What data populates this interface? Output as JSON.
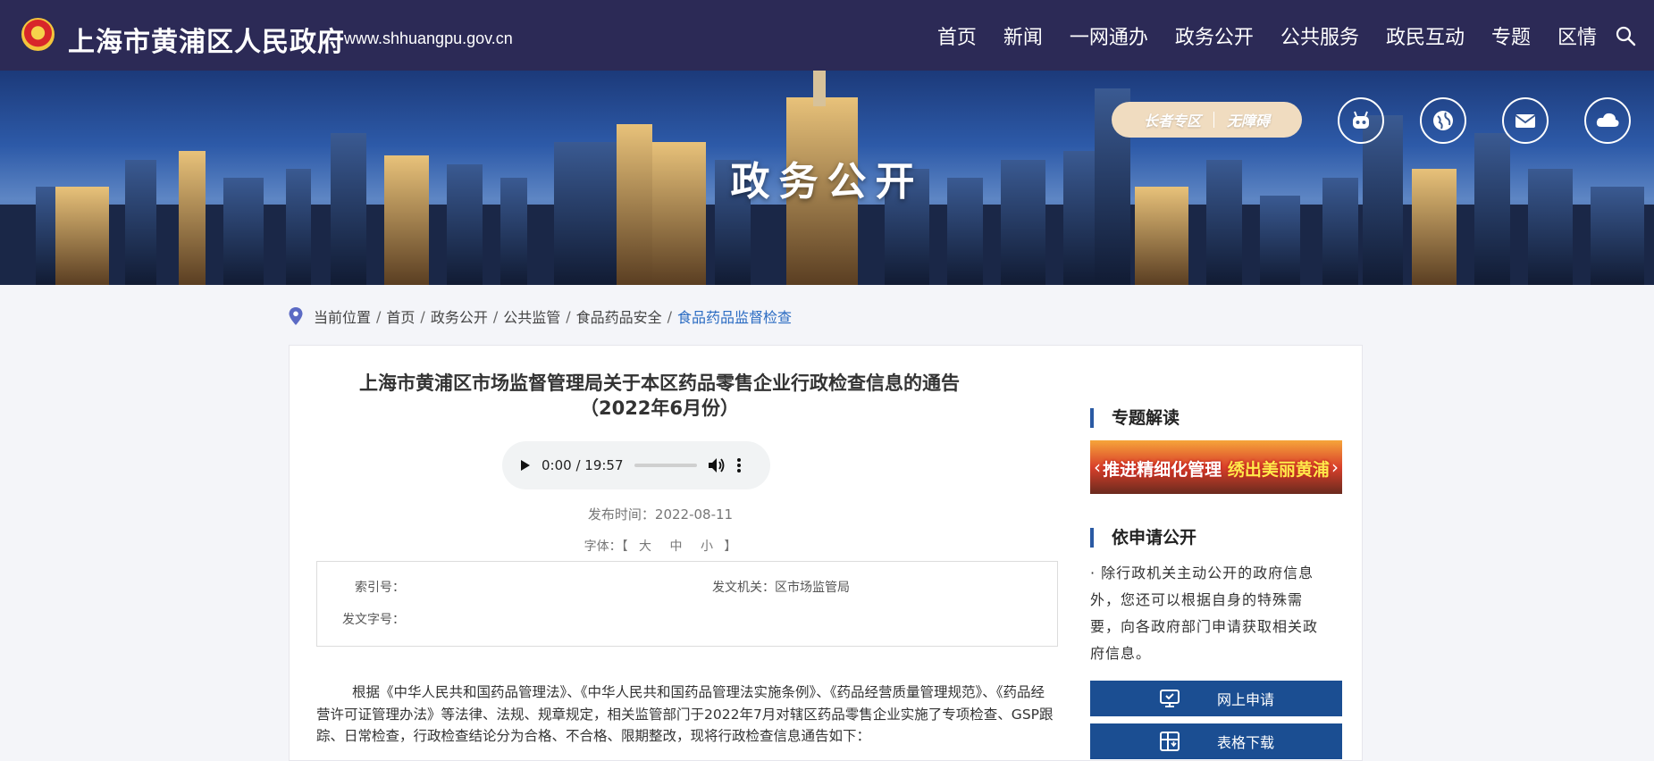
{
  "header": {
    "site_title": "上海市黄浦区人民政府",
    "site_url": "www.shhuangpu.gov.cn",
    "nav": [
      "首页",
      "新闻",
      "一网通办",
      "政务公开",
      "公共服务",
      "政民互动",
      "专题",
      "区情"
    ]
  },
  "banner": {
    "title": "政务公开",
    "elder_label": "长者专区",
    "accessible_label": "无障碍"
  },
  "breadcrumb": {
    "prefix": "当前位置",
    "items": [
      "首页",
      "政务公开",
      "公共监管",
      "食品药品安全"
    ],
    "current": "食品药品监督检查"
  },
  "article": {
    "title": "上海市黄浦区市场监督管理局关于本区药品零售企业行政检查信息的通告（2022年6月份）",
    "audio_time": "0:00 / 19:57",
    "publish_label": "发布时间：2022-08-11",
    "font_label": "字体：【",
    "font_large": "大",
    "font_medium": "中",
    "font_small": "小",
    "font_end": "】",
    "index_label": "索引号：",
    "issuer_label": "发文机关：区市场监管局",
    "docno_label": "发文字号：",
    "body": "根据《中华人民共和国药品管理法》、《中华人民共和国药品管理法实施条例》、《药品经营质量管理规范》、《药品经营许可证管理办法》等法律、法规、规章规定，相关监管部门于2022年7月对辖区药品零售企业实施了专项检查、GSP跟踪、日常检查，行政检查结论分为合格、不合格、限期整改，现将行政检查信息通告如下："
  },
  "sidebar": {
    "topic_heading": "专题解读",
    "promo_left": "推进精细化管理",
    "promo_right": "绣出美丽黄浦",
    "apply_heading": "依申请公开",
    "apply_desc": "· 除行政机关主动公开的政府信息外，您还可以根据自身的特殊需要，向各政府部门申请获取相关政府信息。",
    "online_apply": "网上申请",
    "form_download": "表格下载"
  },
  "colors": {
    "header_bg": "#2c2a56",
    "accent_blue": "#1b4e92",
    "breadcrumb_current": "#2a6bc2"
  }
}
